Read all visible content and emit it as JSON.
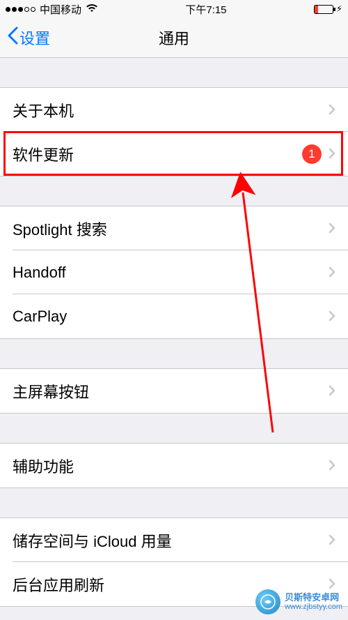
{
  "status": {
    "carrier": "中国移动",
    "time": "下午7:15",
    "battery_low_color": "#ff3b30"
  },
  "nav": {
    "back_label": "设置",
    "title": "通用"
  },
  "groups": [
    {
      "rows": [
        {
          "label": "关于本机",
          "badge": null
        },
        {
          "label": "软件更新",
          "badge": "1"
        }
      ]
    },
    {
      "rows": [
        {
          "label": "Spotlight 搜索",
          "badge": null
        },
        {
          "label": "Handoff",
          "badge": null
        },
        {
          "label": "CarPlay",
          "badge": null
        }
      ]
    },
    {
      "rows": [
        {
          "label": "主屏幕按钮",
          "badge": null
        }
      ]
    },
    {
      "rows": [
        {
          "label": "辅助功能",
          "badge": null
        }
      ]
    },
    {
      "rows": [
        {
          "label": "储存空间与 iCloud 用量",
          "badge": null
        },
        {
          "label": "后台应用刷新",
          "badge": null
        }
      ]
    }
  ],
  "annotation": {
    "highlight_row_label": "软件更新",
    "badge_value": "1",
    "badge_color": "#ff3b30",
    "highlight_color": "#ff0000"
  },
  "watermark": {
    "line1": "贝斯特安卓网",
    "line2": "www.zjbstyy.com"
  }
}
